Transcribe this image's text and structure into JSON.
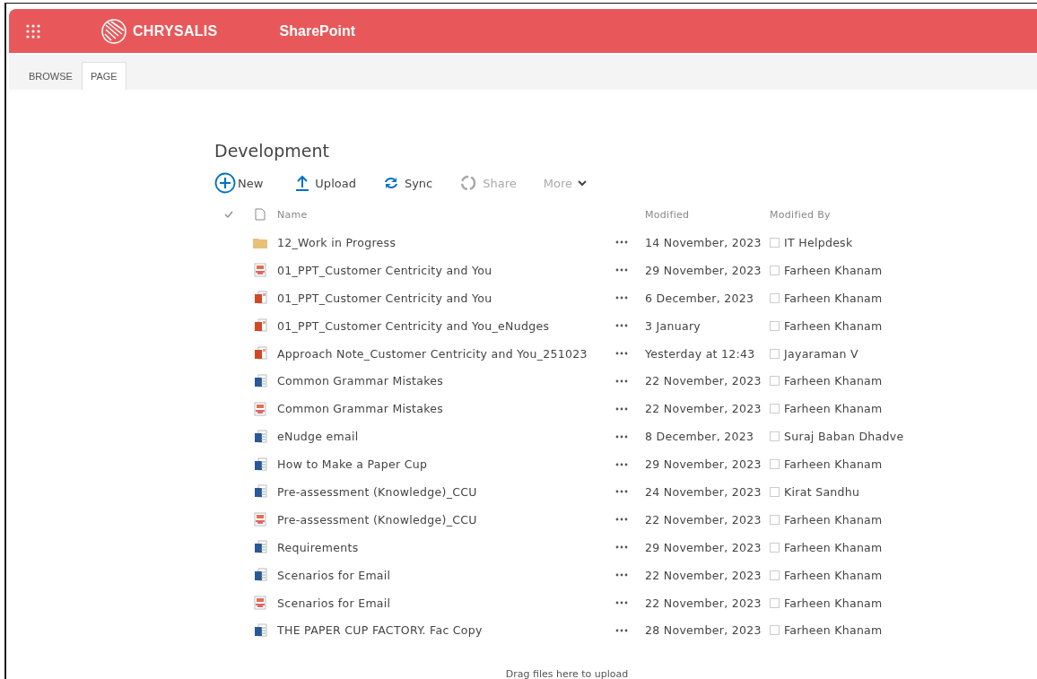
{
  "header": {
    "logo": "CHRYSALIS",
    "app": "SharePoint"
  },
  "tabs": [
    {
      "label": "BROWSE",
      "selected": false
    },
    {
      "label": "PAGE",
      "selected": true
    }
  ],
  "library": {
    "title": "Development",
    "toolbar": [
      {
        "kind": "new",
        "label": "New",
        "disabled": false
      },
      {
        "kind": "upload",
        "label": "Upload",
        "disabled": false
      },
      {
        "kind": "sync",
        "label": "Sync",
        "disabled": false
      },
      {
        "kind": "share",
        "label": "Share",
        "disabled": true
      },
      {
        "kind": "more",
        "label": "More",
        "disabled": true
      }
    ],
    "columns": {
      "name": "Name",
      "modified": "Modified",
      "modified_by": "Modified By"
    },
    "rows": [
      {
        "kind": "folder",
        "name": "12_Work in Progress",
        "modified": "14 November, 2023",
        "modified_by": "IT Helpdesk"
      },
      {
        "kind": "pdf",
        "name": "01_PPT_Customer Centricity and You",
        "modified": "29 November, 2023",
        "modified_by": "Farheen Khanam"
      },
      {
        "kind": "ppt",
        "name": "01_PPT_Customer Centricity and You",
        "modified": "6 December, 2023",
        "modified_by": "Farheen Khanam"
      },
      {
        "kind": "ppt",
        "name": "01_PPT_Customer Centricity and You_eNudges",
        "modified": "3 January",
        "modified_by": "Farheen Khanam"
      },
      {
        "kind": "ppt",
        "name": "Approach Note_Customer Centricity and You_251023",
        "modified": "Yesterday at 12:43",
        "modified_by": "Jayaraman V"
      },
      {
        "kind": "word",
        "name": "Common Grammar Mistakes",
        "modified": "22 November, 2023",
        "modified_by": "Farheen Khanam"
      },
      {
        "kind": "pdf",
        "name": "Common Grammar Mistakes",
        "modified": "22 November, 2023",
        "modified_by": "Farheen Khanam"
      },
      {
        "kind": "word",
        "name": "eNudge email",
        "modified": "8 December, 2023",
        "modified_by": "Suraj Baban Dhadve"
      },
      {
        "kind": "word",
        "name": "How to Make a Paper Cup",
        "modified": "29 November, 2023",
        "modified_by": "Farheen Khanam"
      },
      {
        "kind": "word",
        "name": "Pre-assessment (Knowledge)_CCU",
        "modified": "24 November, 2023",
        "modified_by": "Kirat Sandhu"
      },
      {
        "kind": "pdf",
        "name": "Pre-assessment (Knowledge)_CCU",
        "modified": "22 November, 2023",
        "modified_by": "Farheen Khanam"
      },
      {
        "kind": "word",
        "name": "Requirements",
        "modified": "29 November, 2023",
        "modified_by": "Farheen Khanam"
      },
      {
        "kind": "word",
        "name": "Scenarios for Email",
        "modified": "22 November, 2023",
        "modified_by": "Farheen Khanam"
      },
      {
        "kind": "pdf",
        "name": "Scenarios for Email",
        "modified": "22 November, 2023",
        "modified_by": "Farheen Khanam"
      },
      {
        "kind": "word",
        "name": "THE PAPER CUP FACTORY. Fac Copy",
        "modified": "28 November, 2023",
        "modified_by": "Farheen Khanam"
      }
    ],
    "drop_hint": "Drag files here to upload"
  }
}
